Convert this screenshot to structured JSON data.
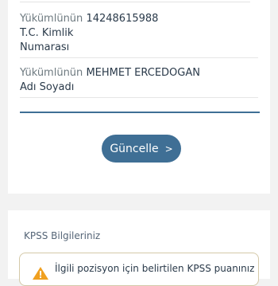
{
  "identity": {
    "tc_label_prefix": "Yükümlünün",
    "tc_value": "14248615988",
    "tc_label_line2": "T.C. Kimlik",
    "tc_label_line3": "Numarası",
    "name_label_prefix": "Yükümlünün",
    "name_value": "MEHMET ERCEDOGAN",
    "name_label_line2": "Adı Soyadı"
  },
  "actions": {
    "update_label": "Güncelle",
    "update_chevron": ">"
  },
  "kpss": {
    "section_title": "KPSS Bilgileriniz",
    "info_text": "İlgili pozisyon için belirtilen KPSS puanınız",
    "warning_color": "#f0a020"
  }
}
